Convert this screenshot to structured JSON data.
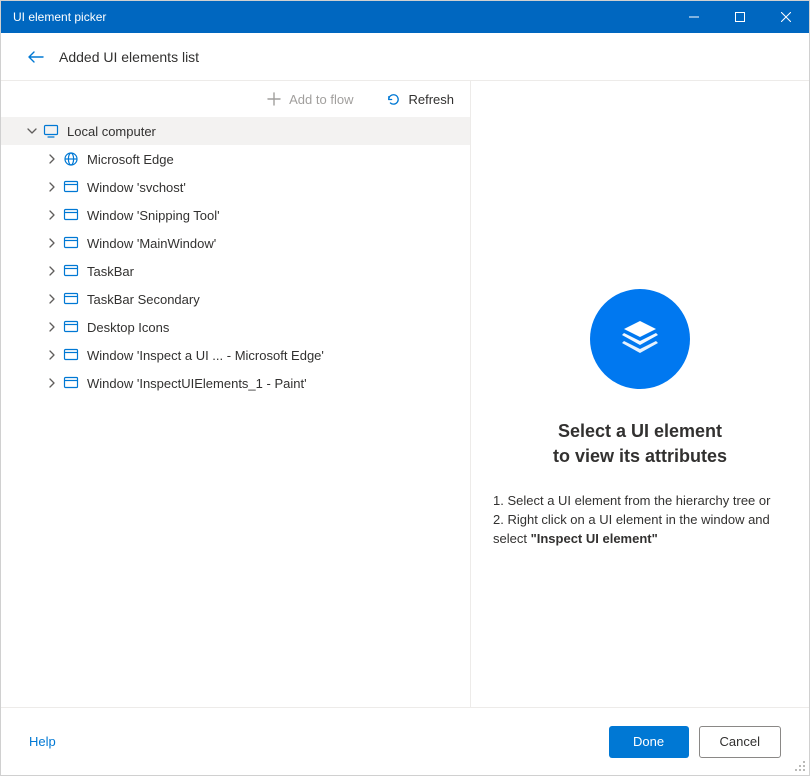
{
  "window": {
    "title": "UI element picker"
  },
  "header": {
    "breadcrumb": "Added UI elements list"
  },
  "toolbar": {
    "add_label": "Add to flow",
    "refresh_label": "Refresh"
  },
  "tree": {
    "root_label": "Local computer",
    "items": [
      {
        "label": "Microsoft Edge",
        "icon": "globe"
      },
      {
        "label": "Window 'svchost'",
        "icon": "window"
      },
      {
        "label": "Window 'Snipping Tool'",
        "icon": "window"
      },
      {
        "label": "Window 'MainWindow'",
        "icon": "window"
      },
      {
        "label": "TaskBar",
        "icon": "window"
      },
      {
        "label": "TaskBar Secondary",
        "icon": "window"
      },
      {
        "label": "Desktop Icons",
        "icon": "window"
      },
      {
        "label": "Window 'Inspect a UI  ...  - Microsoft Edge'",
        "icon": "window"
      },
      {
        "label": "Window 'InspectUIElements_1 - Paint'",
        "icon": "window"
      }
    ]
  },
  "empty_state": {
    "title_line1": "Select a UI element",
    "title_line2": "to view its attributes",
    "line1": "1. Select a UI element from the hierarchy tree or",
    "line2_a": "2. Right click on a UI element in the window and select ",
    "line2_b": "\"Inspect UI element\""
  },
  "footer": {
    "help": "Help",
    "done": "Done",
    "cancel": "Cancel"
  }
}
